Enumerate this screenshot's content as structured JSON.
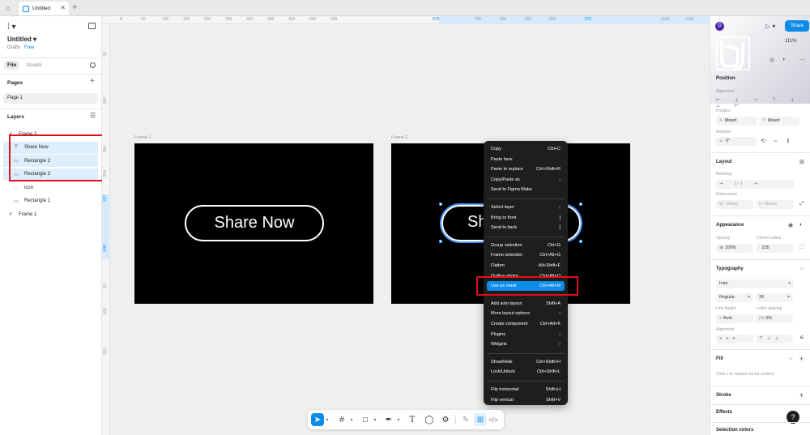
{
  "titlebar": {
    "tab_label": "Untitled"
  },
  "file": {
    "name": "Untitled",
    "location": "Drafts",
    "plan": "Free"
  },
  "left_tabs": [
    "File",
    "Assets"
  ],
  "pages": {
    "label": "Pages",
    "items": [
      "Page 1"
    ]
  },
  "layers": {
    "label": "Layers",
    "items": [
      {
        "name": "Frame 2",
        "icon": "#",
        "selected": false,
        "indent": 0
      },
      {
        "name": "Share Now",
        "icon": "T",
        "selected": true,
        "indent": 1
      },
      {
        "name": "Rectangle 2",
        "icon": "▭",
        "selected": true,
        "indent": 1
      },
      {
        "name": "Rectangle 3",
        "icon": "▭",
        "selected": true,
        "indent": 1
      },
      {
        "name": "icon",
        "icon": "◌",
        "selected": false,
        "indent": 1
      },
      {
        "name": "Rectangle 1",
        "icon": "▭",
        "selected": false,
        "indent": 1
      },
      {
        "name": "Frame 1",
        "icon": "#",
        "selected": false,
        "indent": 0
      }
    ]
  },
  "ruler_top": [
    "0",
    "50",
    "100",
    "150",
    "200",
    "250",
    "300",
    "350",
    "400",
    "450",
    "500",
    "673",
    "750",
    "800",
    "850",
    "900",
    "972",
    "1100",
    "1150"
  ],
  "ruler_left": [
    "50",
    "100",
    "150",
    "200",
    "-227",
    "-348",
    "50",
    "100",
    "150"
  ],
  "canvas": {
    "frame1_label": "Frame 1",
    "frame2_label": "Frame 2",
    "button_text": "Share Now",
    "button2_text_visible": "Sh"
  },
  "context_menu": [
    {
      "label": "Copy",
      "shortcut": "Ctrl+C"
    },
    {
      "label": "Paste here",
      "shortcut": ""
    },
    {
      "label": "Paste to replace",
      "shortcut": "Ctrl+Shift+R"
    },
    {
      "label": "Copy/Paste as",
      "shortcut": "›"
    },
    {
      "label": "Send to Figma Make",
      "shortcut": ""
    },
    {
      "sep": true
    },
    {
      "label": "Select layer",
      "shortcut": "›"
    },
    {
      "label": "Bring to front",
      "shortcut": "]"
    },
    {
      "label": "Send to back",
      "shortcut": "["
    },
    {
      "sep": true
    },
    {
      "label": "Group selection",
      "shortcut": "Ctrl+G"
    },
    {
      "label": "Frame selection",
      "shortcut": "Ctrl+Alt+G"
    },
    {
      "label": "Flatten",
      "shortcut": "Alt+Shift+F"
    },
    {
      "label": "Outline stroke",
      "shortcut": "Ctrl+Alt+O"
    },
    {
      "label": "Use as mask",
      "shortcut": "Ctrl+Alt+M",
      "highlight": true
    },
    {
      "sep": true
    },
    {
      "label": "Add auto layout",
      "shortcut": "Shift+A"
    },
    {
      "label": "More layout options",
      "shortcut": "›"
    },
    {
      "label": "Create component",
      "shortcut": "Ctrl+Alt+K"
    },
    {
      "label": "Plugins",
      "shortcut": "›"
    },
    {
      "label": "Widgets",
      "shortcut": "›"
    },
    {
      "sep": true
    },
    {
      "label": "Show/Hide",
      "shortcut": "Ctrl+Shift+H"
    },
    {
      "label": "Lock/Unlock",
      "shortcut": "Ctrl+Shift+L"
    },
    {
      "sep": true
    },
    {
      "label": "Flip horizontal",
      "shortcut": "Shift+H"
    },
    {
      "label": "Flip vertical",
      "shortcut": "Shift+V"
    }
  ],
  "right": {
    "avatar_initial": "D",
    "share_label": "Share",
    "zoom": "111%",
    "position": {
      "label": "Position",
      "alignment": "Alignment",
      "pos_label": "Position",
      "x": "Mixed",
      "y": "Mixed",
      "x_prefix": "X",
      "y_prefix": "Y",
      "rotation_label": "Rotation",
      "rotation": "0°"
    },
    "layout": {
      "label": "Layout",
      "resizing": "Resizing",
      "dimensions": "Dimensions",
      "w": "Mixed",
      "h": "Mixed",
      "w_prefix": "W",
      "h_prefix": "H"
    },
    "appearance": {
      "label": "Appearance",
      "opacity_label": "Opacity",
      "opacity": "100%",
      "radius_label": "Corner radius",
      "radius": "235"
    },
    "typography": {
      "label": "Typography",
      "font": "Inter",
      "weight": "Regular",
      "size": "36",
      "line_height_label": "Line height",
      "line_height": "Auto",
      "letter_spacing_label": "Letter spacing",
      "letter_spacing": "0%",
      "alignment_label": "Alignment"
    },
    "fill": {
      "label": "Fill",
      "hint": "Click + to replace mixed content"
    },
    "stroke_label": "Stroke",
    "effects_label": "Effects",
    "selection_colors_label": "Selection colors"
  },
  "colors": {
    "accent": "#0c8ce9",
    "highlight_box": "#e0101a",
    "menu_bg": "#1e1e1e"
  }
}
